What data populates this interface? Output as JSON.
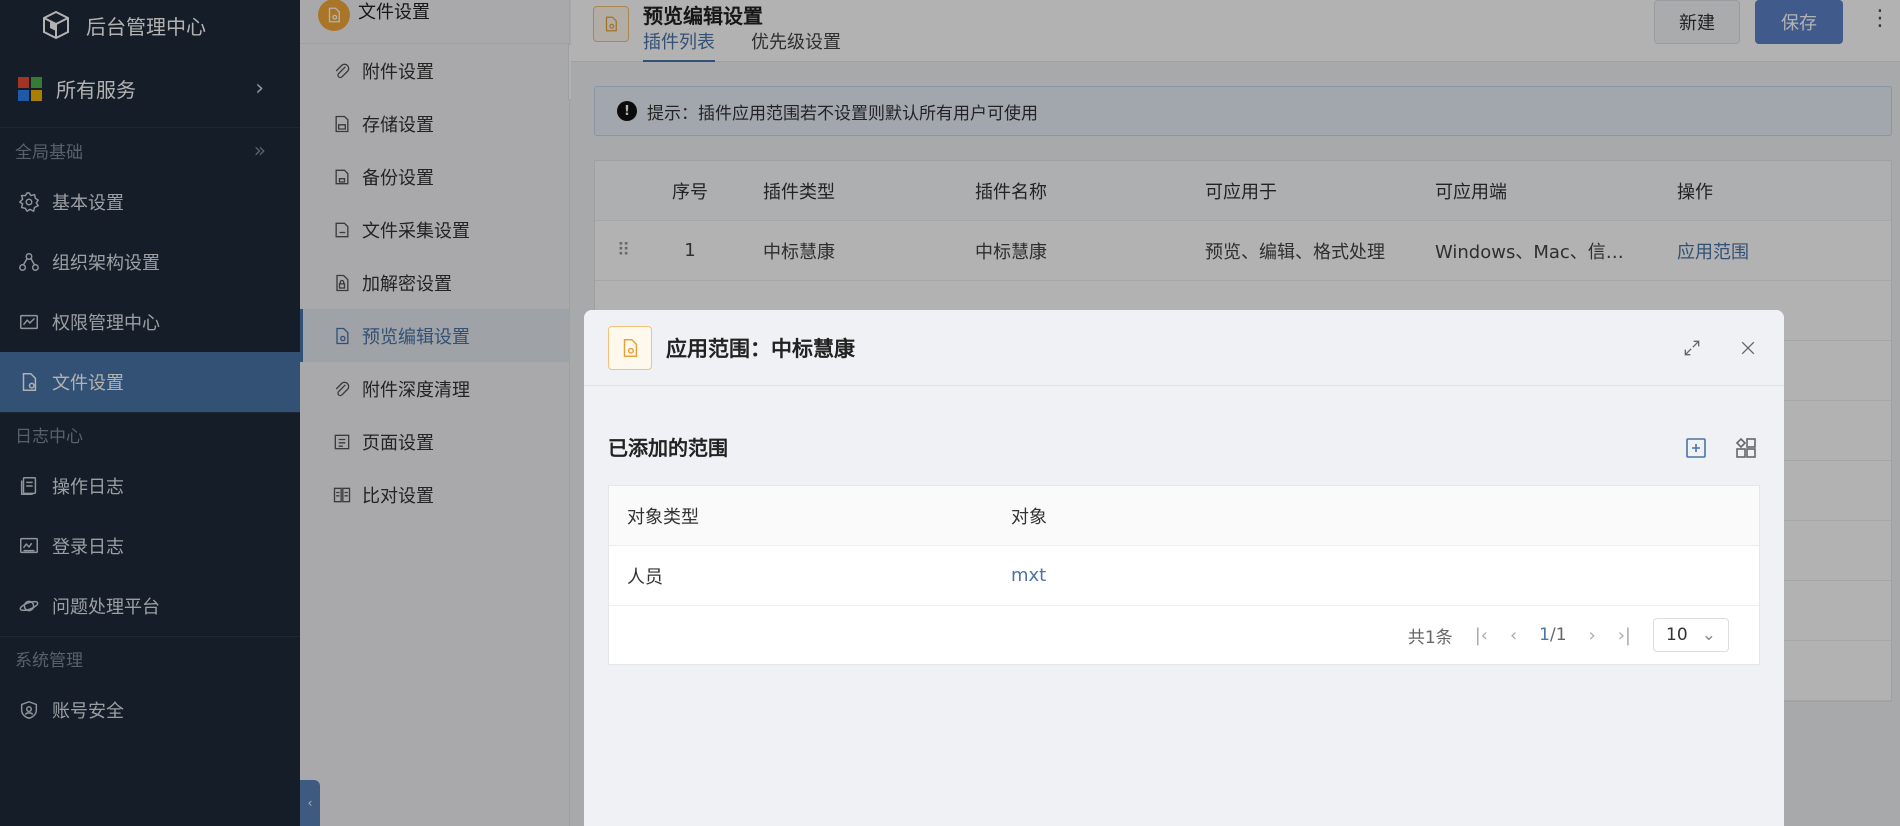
{
  "brand": {
    "title": "后台管理中心"
  },
  "sidebar": {
    "all_services": "所有服务",
    "groups": [
      {
        "label": "全局基础"
      },
      {
        "label": "日志中心"
      },
      {
        "label": "系统管理"
      }
    ],
    "items": [
      {
        "label": "基本设置",
        "icon": "gear-icon"
      },
      {
        "label": "组织架构设置",
        "icon": "org-icon"
      },
      {
        "label": "权限管理中心",
        "icon": "permission-icon"
      },
      {
        "label": "文件设置",
        "icon": "file-icon",
        "active": true
      },
      {
        "label": "操作日志",
        "icon": "log-icon"
      },
      {
        "label": "登录日志",
        "icon": "login-log-icon"
      },
      {
        "label": "问题处理平台",
        "icon": "planet-icon"
      },
      {
        "label": "账号安全",
        "icon": "shield-icon"
      }
    ]
  },
  "submenu": {
    "title": "文件设置",
    "items": [
      {
        "label": "附件设置",
        "icon": "paperclip-icon"
      },
      {
        "label": "存储设置",
        "icon": "storage-icon"
      },
      {
        "label": "备份设置",
        "icon": "backup-icon"
      },
      {
        "label": "文件采集设置",
        "icon": "collect-icon"
      },
      {
        "label": "加解密设置",
        "icon": "lock-icon"
      },
      {
        "label": "预览编辑设置",
        "icon": "preview-icon",
        "active": true
      },
      {
        "label": "附件深度清理",
        "icon": "clean-icon"
      },
      {
        "label": "页面设置",
        "icon": "page-icon"
      },
      {
        "label": "比对设置",
        "icon": "compare-icon"
      }
    ]
  },
  "header": {
    "title": "预览编辑设置",
    "tabs": [
      {
        "label": "插件列表",
        "active": true
      },
      {
        "label": "优先级设置"
      }
    ],
    "new_label": "新建",
    "save_label": "保存"
  },
  "notice": {
    "text": "提示：插件应用范围若不设置则默认所有用户可使用"
  },
  "plugin_table": {
    "columns": [
      "序号",
      "插件类型",
      "插件名称",
      "可应用于",
      "可应用端",
      "操作"
    ],
    "rows": [
      {
        "index": "1",
        "type": "中标慧康",
        "name": "中标慧康",
        "apply": "预览、编辑、格式处理",
        "platform": "Windows、Mac、信…",
        "action": "应用范围"
      }
    ]
  },
  "modal": {
    "title": "应用范围：中标慧康",
    "section_title": "已添加的范围",
    "columns": [
      "对象类型",
      "对象"
    ],
    "rows": [
      {
        "type": "人员",
        "object": "mxt"
      }
    ],
    "pager": {
      "total": "共1条",
      "page": "1",
      "pages": "/1",
      "page_size": "10"
    }
  },
  "colors": {
    "sidebar_bg": "#1e2a3a",
    "accent": "#4a74a8",
    "save_btn": "#5b82c8",
    "icon_orange": "#e8a23b"
  }
}
